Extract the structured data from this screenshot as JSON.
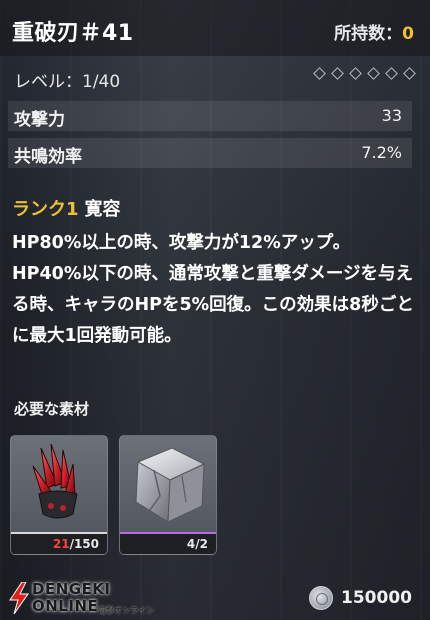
{
  "header": {
    "weapon_name": "重破刃＃41",
    "owned_label": "所持数：",
    "owned_count": "0"
  },
  "level": {
    "text": "レベル：1/40",
    "diamonds": [
      "◇",
      "◇",
      "◇",
      "◇",
      "◇",
      "◇"
    ]
  },
  "stats": [
    {
      "label": "攻撃力",
      "value": "33"
    },
    {
      "label": "共鳴効率",
      "value": "7.2%"
    }
  ],
  "rank": {
    "tag": "ランク1",
    "name": "寛容"
  },
  "description": "HP80%以上の時、攻撃力が12%アップ。HP40%以下の時、通常攻撃と重撃ダメージを与える時、キャラのHPを5%回復。この効果は8秒ごとに最大1回発動可能。",
  "materials": {
    "title": "必要な素材",
    "items": [
      {
        "icon": "red-crystal-icon",
        "have": "21",
        "need": "/150",
        "rarity_color": "#d8d8dc"
      },
      {
        "icon": "metal-cube-icon",
        "have": "4",
        "need": "/2",
        "rarity_color": "#b070e0"
      }
    ]
  },
  "footer": {
    "cost_icon": "shell-coin-icon",
    "cost_value": "150000",
    "watermark_line1": "DENGEKI",
    "watermark_line2": "ONLINE",
    "watermark_small": "電撃オンライン"
  },
  "colors": {
    "accent": "#f0c030",
    "shortage": "#ff4040"
  }
}
